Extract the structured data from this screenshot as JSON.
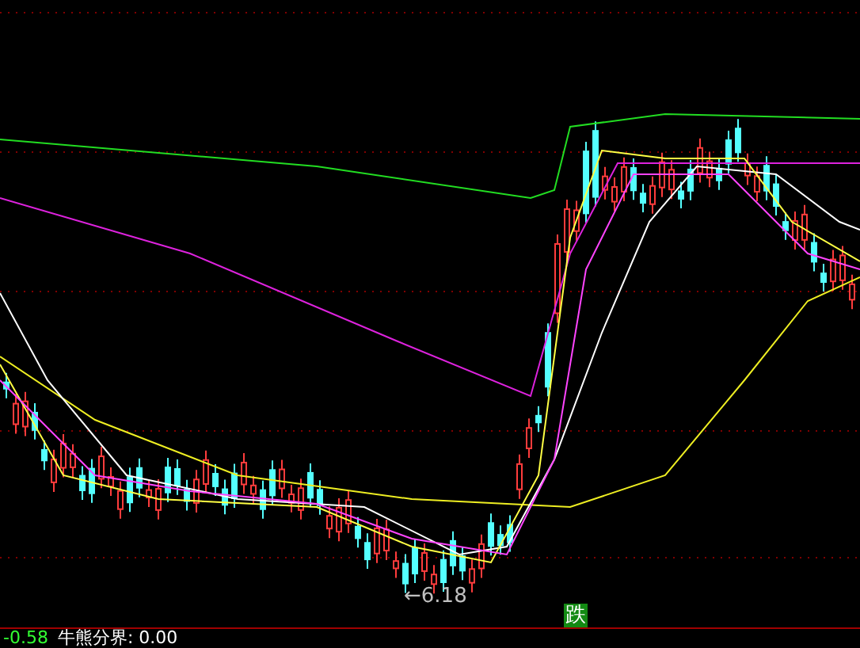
{
  "chart": {
    "low_marker": "←6.18",
    "signal_badge": "跌"
  },
  "indicator_bar": {
    "value": "-0.58",
    "label": "牛熊分界: 0.00"
  }
}
